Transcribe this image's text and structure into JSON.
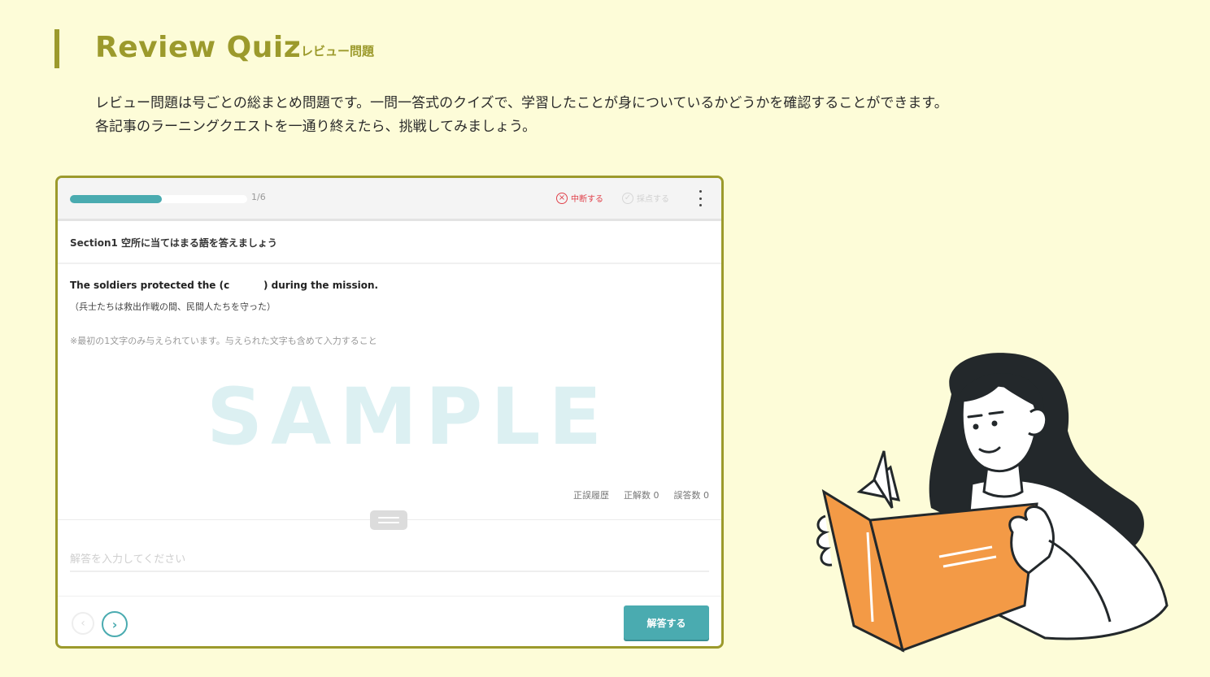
{
  "header": {
    "title": "Review Quiz",
    "subtitle": "レビュー問題"
  },
  "intro": {
    "line1": "レビュー問題は号ごとの総まとめ問題です。一問一答式のクイズで、学習したことが身についているかどうかを確認することができます。",
    "line2": "各記事のラーニングクエストを一通り終えたら、挑戦してみましょう。"
  },
  "quiz": {
    "progress_text": "1/6",
    "progress_fraction": 0.167,
    "pause_label": "中断する",
    "grade_label": "採点する",
    "section_title": "Section1 空所に当てはまる語を答えましょう",
    "question": "The soldiers protected the (c          ) during the mission.",
    "translation": "（兵士たちは救出作戦の間、民間人たちを守った）",
    "note": "※最初の1文字のみ与えられています。与えられた文字も含めて入力すること",
    "watermark": "SAMPLE",
    "stats": {
      "history_label": "正誤履歴",
      "correct_label": "正解数 0",
      "wrong_label": "誤答数 0"
    },
    "answer_placeholder": "解答を入力してください",
    "submit_label": "解答する"
  },
  "icons": {
    "pause": "close-circle-icon",
    "grade": "check-circle-icon",
    "menu": "kebab-menu-icon",
    "prev": "chevron-left-icon",
    "next": "chevron-right-icon"
  },
  "colors": {
    "accent": "#9c9a2c",
    "teal": "#4aabb0",
    "background": "#fdfcd8",
    "danger": "#e0404a",
    "book": "#f39a46"
  }
}
